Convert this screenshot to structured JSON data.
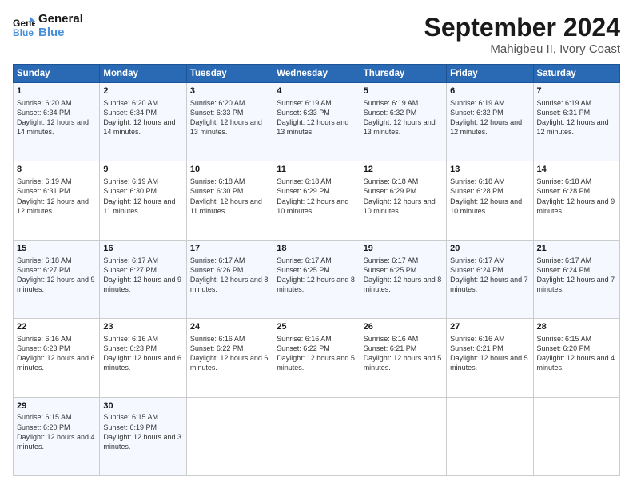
{
  "logo": {
    "line1": "General",
    "line2": "Blue"
  },
  "header": {
    "month": "September 2024",
    "location": "Mahigbeu II, Ivory Coast"
  },
  "days_of_week": [
    "Sunday",
    "Monday",
    "Tuesday",
    "Wednesday",
    "Thursday",
    "Friday",
    "Saturday"
  ],
  "weeks": [
    [
      {
        "day": "1",
        "sunrise": "Sunrise: 6:20 AM",
        "sunset": "Sunset: 6:34 PM",
        "daylight": "Daylight: 12 hours and 14 minutes."
      },
      {
        "day": "2",
        "sunrise": "Sunrise: 6:20 AM",
        "sunset": "Sunset: 6:34 PM",
        "daylight": "Daylight: 12 hours and 14 minutes."
      },
      {
        "day": "3",
        "sunrise": "Sunrise: 6:20 AM",
        "sunset": "Sunset: 6:33 PM",
        "daylight": "Daylight: 12 hours and 13 minutes."
      },
      {
        "day": "4",
        "sunrise": "Sunrise: 6:19 AM",
        "sunset": "Sunset: 6:33 PM",
        "daylight": "Daylight: 12 hours and 13 minutes."
      },
      {
        "day": "5",
        "sunrise": "Sunrise: 6:19 AM",
        "sunset": "Sunset: 6:32 PM",
        "daylight": "Daylight: 12 hours and 13 minutes."
      },
      {
        "day": "6",
        "sunrise": "Sunrise: 6:19 AM",
        "sunset": "Sunset: 6:32 PM",
        "daylight": "Daylight: 12 hours and 12 minutes."
      },
      {
        "day": "7",
        "sunrise": "Sunrise: 6:19 AM",
        "sunset": "Sunset: 6:31 PM",
        "daylight": "Daylight: 12 hours and 12 minutes."
      }
    ],
    [
      {
        "day": "8",
        "sunrise": "Sunrise: 6:19 AM",
        "sunset": "Sunset: 6:31 PM",
        "daylight": "Daylight: 12 hours and 12 minutes."
      },
      {
        "day": "9",
        "sunrise": "Sunrise: 6:19 AM",
        "sunset": "Sunset: 6:30 PM",
        "daylight": "Daylight: 12 hours and 11 minutes."
      },
      {
        "day": "10",
        "sunrise": "Sunrise: 6:18 AM",
        "sunset": "Sunset: 6:30 PM",
        "daylight": "Daylight: 12 hours and 11 minutes."
      },
      {
        "day": "11",
        "sunrise": "Sunrise: 6:18 AM",
        "sunset": "Sunset: 6:29 PM",
        "daylight": "Daylight: 12 hours and 10 minutes."
      },
      {
        "day": "12",
        "sunrise": "Sunrise: 6:18 AM",
        "sunset": "Sunset: 6:29 PM",
        "daylight": "Daylight: 12 hours and 10 minutes."
      },
      {
        "day": "13",
        "sunrise": "Sunrise: 6:18 AM",
        "sunset": "Sunset: 6:28 PM",
        "daylight": "Daylight: 12 hours and 10 minutes."
      },
      {
        "day": "14",
        "sunrise": "Sunrise: 6:18 AM",
        "sunset": "Sunset: 6:28 PM",
        "daylight": "Daylight: 12 hours and 9 minutes."
      }
    ],
    [
      {
        "day": "15",
        "sunrise": "Sunrise: 6:18 AM",
        "sunset": "Sunset: 6:27 PM",
        "daylight": "Daylight: 12 hours and 9 minutes."
      },
      {
        "day": "16",
        "sunrise": "Sunrise: 6:17 AM",
        "sunset": "Sunset: 6:27 PM",
        "daylight": "Daylight: 12 hours and 9 minutes."
      },
      {
        "day": "17",
        "sunrise": "Sunrise: 6:17 AM",
        "sunset": "Sunset: 6:26 PM",
        "daylight": "Daylight: 12 hours and 8 minutes."
      },
      {
        "day": "18",
        "sunrise": "Sunrise: 6:17 AM",
        "sunset": "Sunset: 6:25 PM",
        "daylight": "Daylight: 12 hours and 8 minutes."
      },
      {
        "day": "19",
        "sunrise": "Sunrise: 6:17 AM",
        "sunset": "Sunset: 6:25 PM",
        "daylight": "Daylight: 12 hours and 8 minutes."
      },
      {
        "day": "20",
        "sunrise": "Sunrise: 6:17 AM",
        "sunset": "Sunset: 6:24 PM",
        "daylight": "Daylight: 12 hours and 7 minutes."
      },
      {
        "day": "21",
        "sunrise": "Sunrise: 6:17 AM",
        "sunset": "Sunset: 6:24 PM",
        "daylight": "Daylight: 12 hours and 7 minutes."
      }
    ],
    [
      {
        "day": "22",
        "sunrise": "Sunrise: 6:16 AM",
        "sunset": "Sunset: 6:23 PM",
        "daylight": "Daylight: 12 hours and 6 minutes."
      },
      {
        "day": "23",
        "sunrise": "Sunrise: 6:16 AM",
        "sunset": "Sunset: 6:23 PM",
        "daylight": "Daylight: 12 hours and 6 minutes."
      },
      {
        "day": "24",
        "sunrise": "Sunrise: 6:16 AM",
        "sunset": "Sunset: 6:22 PM",
        "daylight": "Daylight: 12 hours and 6 minutes."
      },
      {
        "day": "25",
        "sunrise": "Sunrise: 6:16 AM",
        "sunset": "Sunset: 6:22 PM",
        "daylight": "Daylight: 12 hours and 5 minutes."
      },
      {
        "day": "26",
        "sunrise": "Sunrise: 6:16 AM",
        "sunset": "Sunset: 6:21 PM",
        "daylight": "Daylight: 12 hours and 5 minutes."
      },
      {
        "day": "27",
        "sunrise": "Sunrise: 6:16 AM",
        "sunset": "Sunset: 6:21 PM",
        "daylight": "Daylight: 12 hours and 5 minutes."
      },
      {
        "day": "28",
        "sunrise": "Sunrise: 6:15 AM",
        "sunset": "Sunset: 6:20 PM",
        "daylight": "Daylight: 12 hours and 4 minutes."
      }
    ],
    [
      {
        "day": "29",
        "sunrise": "Sunrise: 6:15 AM",
        "sunset": "Sunset: 6:20 PM",
        "daylight": "Daylight: 12 hours and 4 minutes."
      },
      {
        "day": "30",
        "sunrise": "Sunrise: 6:15 AM",
        "sunset": "Sunset: 6:19 PM",
        "daylight": "Daylight: 12 hours and 3 minutes."
      },
      null,
      null,
      null,
      null,
      null
    ]
  ]
}
